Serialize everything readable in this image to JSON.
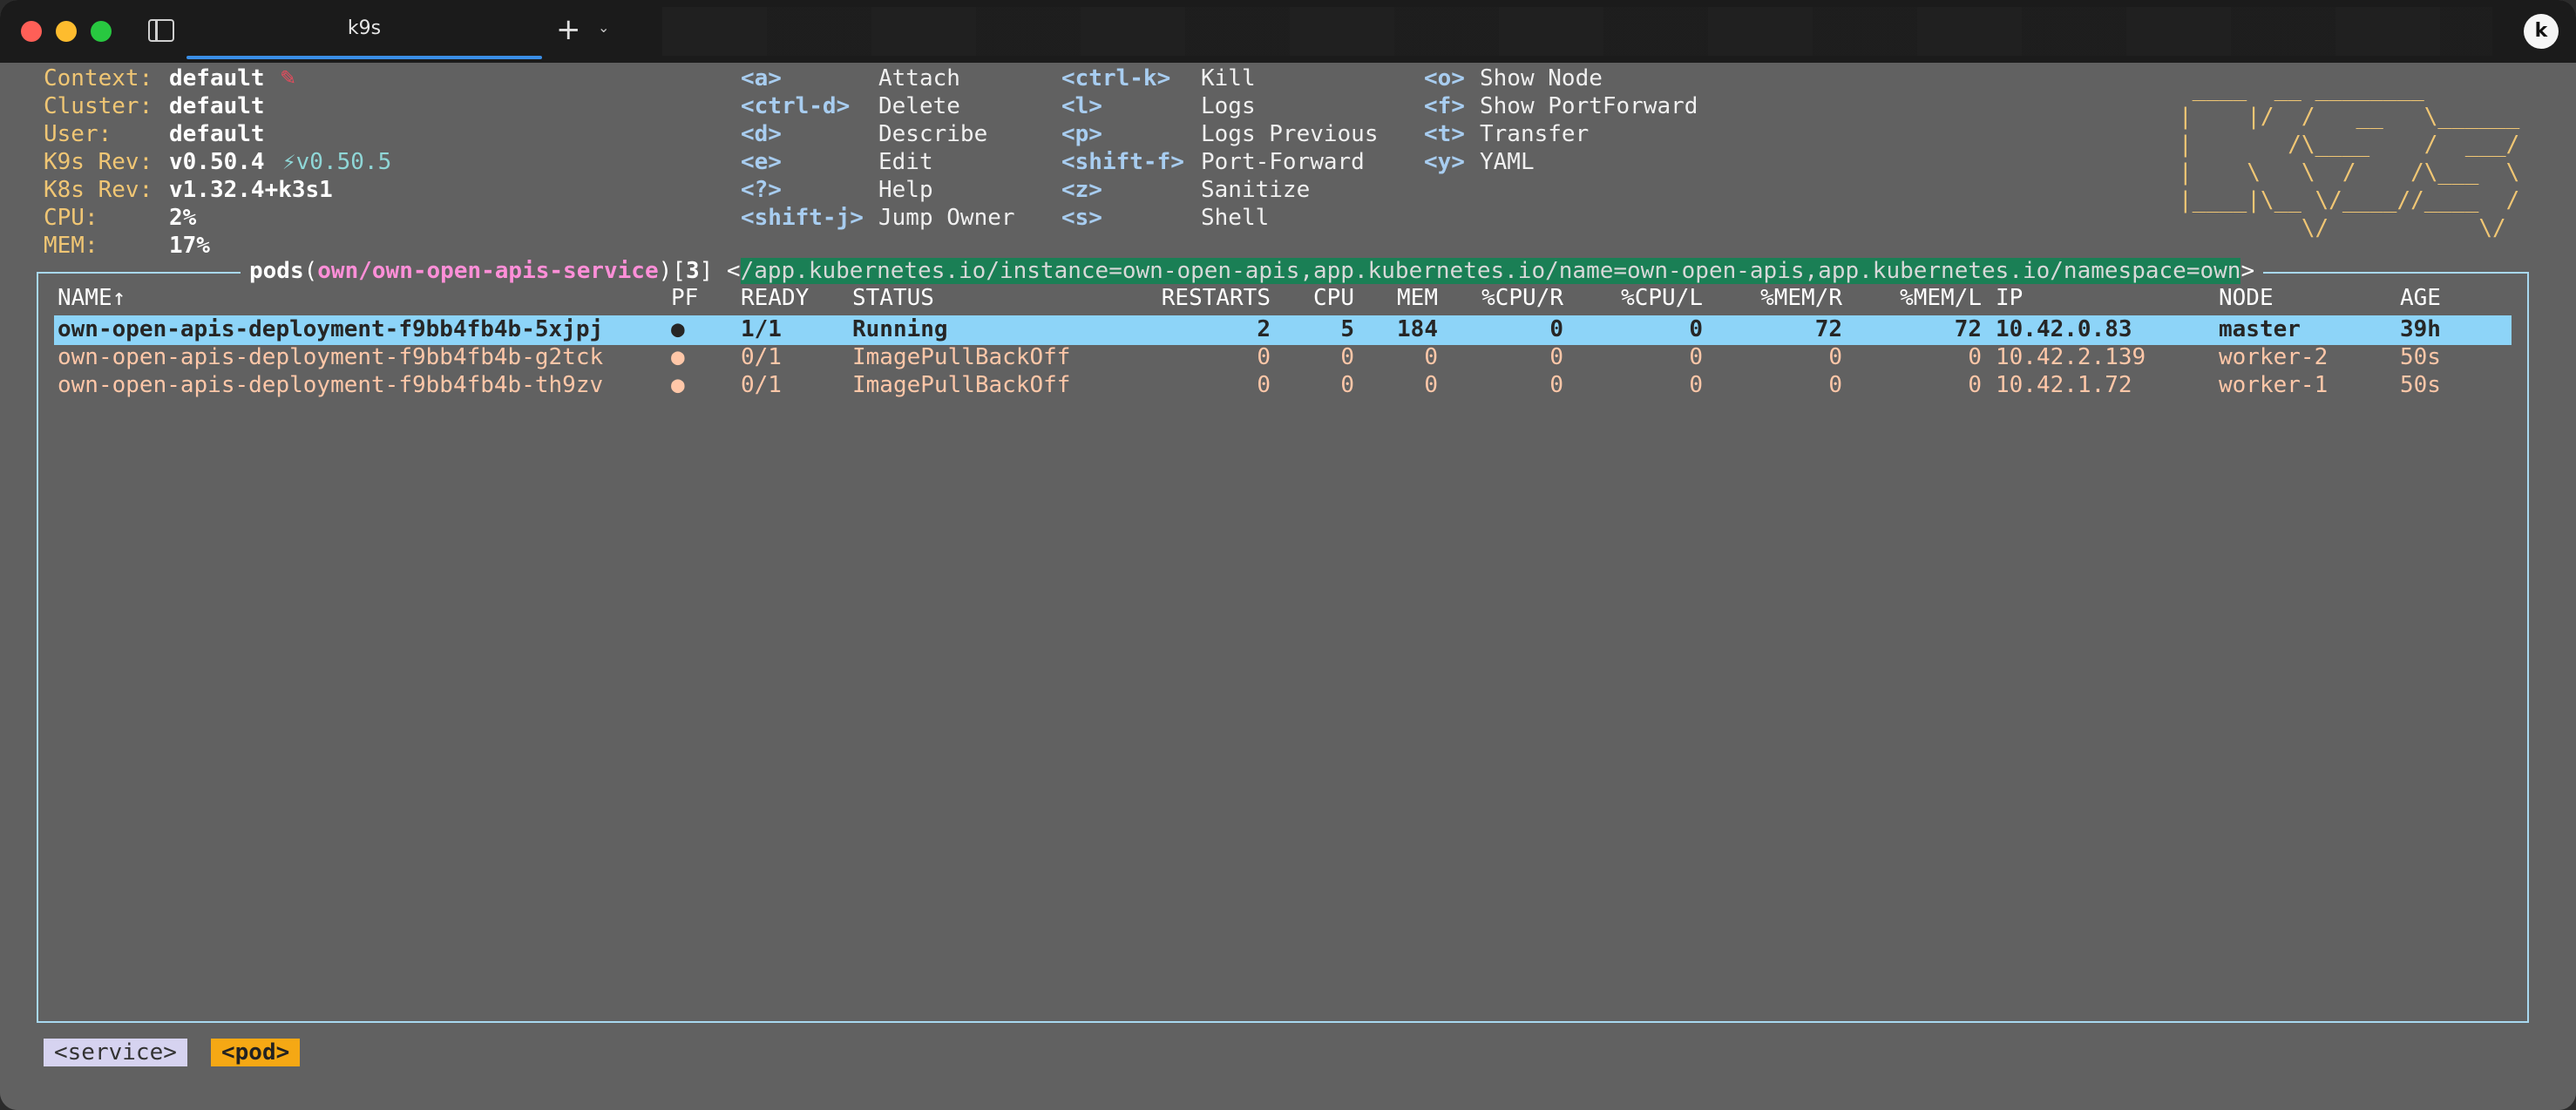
{
  "window": {
    "tab_title": "k9s"
  },
  "info": {
    "labels": [
      "Context:",
      "Cluster:",
      "User:",
      "K9s Rev:",
      "K8s Rev:",
      "CPU:",
      "MEM:"
    ],
    "context": "default",
    "cluster": "default",
    "user": "default",
    "k9s_rev": "v0.50.4",
    "k9s_latest": "⚡v0.50.5",
    "k8s_rev": "v1.32.4+k3s1",
    "cpu": "2%",
    "mem": "17%"
  },
  "shortcuts": {
    "col1": [
      {
        "key": "<a>",
        "label": "Attach"
      },
      {
        "key": "<ctrl-d>",
        "label": "Delete"
      },
      {
        "key": "<d>",
        "label": "Describe"
      },
      {
        "key": "<e>",
        "label": "Edit"
      },
      {
        "key": "<?>",
        "label": "Help"
      },
      {
        "key": "<shift-j>",
        "label": "Jump Owner"
      }
    ],
    "col2": [
      {
        "key": "<ctrl-k>",
        "label": "Kill"
      },
      {
        "key": "<l>",
        "label": "Logs"
      },
      {
        "key": "<p>",
        "label": "Logs Previous"
      },
      {
        "key": "<shift-f>",
        "label": "Port-Forward"
      },
      {
        "key": "<z>",
        "label": "Sanitize"
      },
      {
        "key": "<s>",
        "label": "Shell"
      }
    ],
    "col3": [
      {
        "key": "<o>",
        "label": "Show Node"
      },
      {
        "key": "<f>",
        "label": "Show PortForward"
      },
      {
        "key": "<t>",
        "label": "Transfer"
      },
      {
        "key": "<y>",
        "label": "YAML"
      }
    ]
  },
  "logo": [
    " ____  __ ________       ",
    "|    |/  /   __   \\______",
    "|       /\\____    /  ___/",
    "|    \\   \\  /    /\\___  \\",
    "|____|\\__ \\/____//____  /",
    "         \\/           \\/ "
  ],
  "view": {
    "resource": "pods",
    "path": "own/own-open-apis-service",
    "count": "3",
    "selector": "/app.kubernetes.io/instance=own-open-apis,app.kubernetes.io/name=own-open-apis,app.kubernetes.io/namespace=own"
  },
  "table": {
    "headers": [
      "NAME↑",
      "PF",
      "READY",
      "STATUS",
      "RESTARTS",
      "CPU",
      "MEM",
      "%CPU/R",
      "%CPU/L",
      "%MEM/R",
      "%MEM/L",
      "IP",
      "NODE",
      "AGE"
    ],
    "rows": [
      {
        "name": "own-open-apis-deployment-f9bb4fb4b-5xjpj",
        "pf": "●",
        "ready": "1/1",
        "status": "Running",
        "restarts": "2",
        "cpu": "5",
        "mem": "184",
        "cpu_r": "0",
        "cpu_l": "0",
        "mem_r": "72",
        "mem_l": "72",
        "ip": "10.42.0.83",
        "node": "master",
        "age": "39h"
      },
      {
        "name": "own-open-apis-deployment-f9bb4fb4b-g2tck",
        "pf": "●",
        "ready": "0/1",
        "status": "ImagePullBackOff",
        "restarts": "0",
        "cpu": "0",
        "mem": "0",
        "cpu_r": "0",
        "cpu_l": "0",
        "mem_r": "0",
        "mem_l": "0",
        "ip": "10.42.2.139",
        "node": "worker-2",
        "age": "50s"
      },
      {
        "name": "own-open-apis-deployment-f9bb4fb4b-th9zv",
        "pf": "●",
        "ready": "0/1",
        "status": "ImagePullBackOff",
        "restarts": "0",
        "cpu": "0",
        "mem": "0",
        "cpu_r": "0",
        "cpu_l": "0",
        "mem_r": "0",
        "mem_l": "0",
        "ip": "10.42.1.72",
        "node": "worker-1",
        "age": "50s"
      }
    ]
  },
  "crumbs": [
    "<service>",
    "<pod>"
  ],
  "colors": {
    "selected_row": "#8dd4f8",
    "error_row": "#ffc7a8",
    "accent_orange": "#f5a814",
    "selector_bg": "#1a7f55"
  }
}
